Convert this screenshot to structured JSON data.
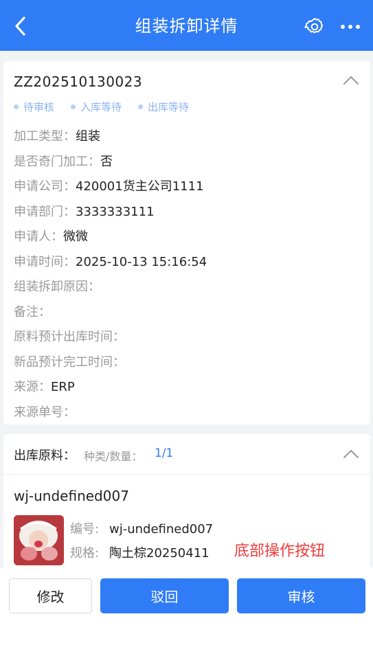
{
  "header": {
    "title": "组装拆卸详情"
  },
  "order": {
    "code": "ZZ202510130023",
    "steps": [
      "待审核",
      "入库等待",
      "出库等待"
    ],
    "fields": [
      {
        "label": "加工类型：",
        "value": "组装"
      },
      {
        "label": "是否奇门加工：",
        "value": "否"
      },
      {
        "label": "申请公司：",
        "value": "420001货主公司1111"
      },
      {
        "label": "申请部门：",
        "value": "3333333111"
      },
      {
        "label": "申请人：",
        "value": "微微"
      },
      {
        "label": "申请时间：",
        "value": "2025-10-13 15:16:54"
      },
      {
        "label": "组装拆卸原因：",
        "value": ""
      },
      {
        "label": "备注：",
        "value": ""
      },
      {
        "label": "原料预计出库时间：",
        "value": ""
      },
      {
        "label": "新品预计完工时间：",
        "value": ""
      },
      {
        "label": "来源：",
        "value": "ERP"
      },
      {
        "label": "来源单号：",
        "value": ""
      }
    ]
  },
  "materials": {
    "title": "出库原料：",
    "kind_label": "种类/数量：",
    "count": "1/1",
    "item": {
      "name": "wj-undefined007",
      "code_label": "编号:",
      "code": "wj-undefined007",
      "spec_label": "规格:",
      "spec": "陶土棕20250411"
    },
    "annotation": "底部操作按钮"
  },
  "actions": {
    "edit": "修改",
    "reject": "驳回",
    "approve": "审核"
  },
  "colors": {
    "primary": "#2f7cf6",
    "annotation": "#ee3b3b"
  }
}
